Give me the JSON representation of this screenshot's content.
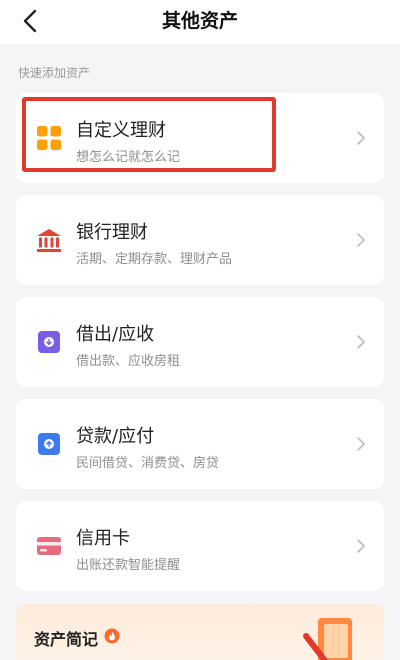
{
  "header": {
    "title": "其他资产",
    "back_icon": "chevron-left-icon"
  },
  "section_label": "快速添加资产",
  "items": [
    {
      "name": "自定义理财",
      "desc": "想怎么记就怎么记",
      "icon": "grid-apps-icon",
      "color": "#ff9f0a"
    },
    {
      "name": "银行理财",
      "desc": "活期、定期存款、理财产品",
      "icon": "bank-icon",
      "color": "#e0443a"
    },
    {
      "name": "借出/应收",
      "desc": "借出款、应收房租",
      "icon": "lend-icon",
      "color": "#7a5ce6"
    },
    {
      "name": "贷款/应付",
      "desc": "民间借贷、消费贷、房贷",
      "icon": "loan-icon",
      "color": "#3d7af0"
    },
    {
      "name": "信用卡",
      "desc": "出账还款智能提醒",
      "icon": "credit-card-icon",
      "color": "#e86a7e"
    }
  ],
  "note": {
    "title": "资产简记",
    "fire_icon": "fire-icon",
    "art_icon": "notebook-pencil-icon"
  },
  "colors": {
    "highlight": "#e2392d",
    "background": "#f5f5f7"
  }
}
